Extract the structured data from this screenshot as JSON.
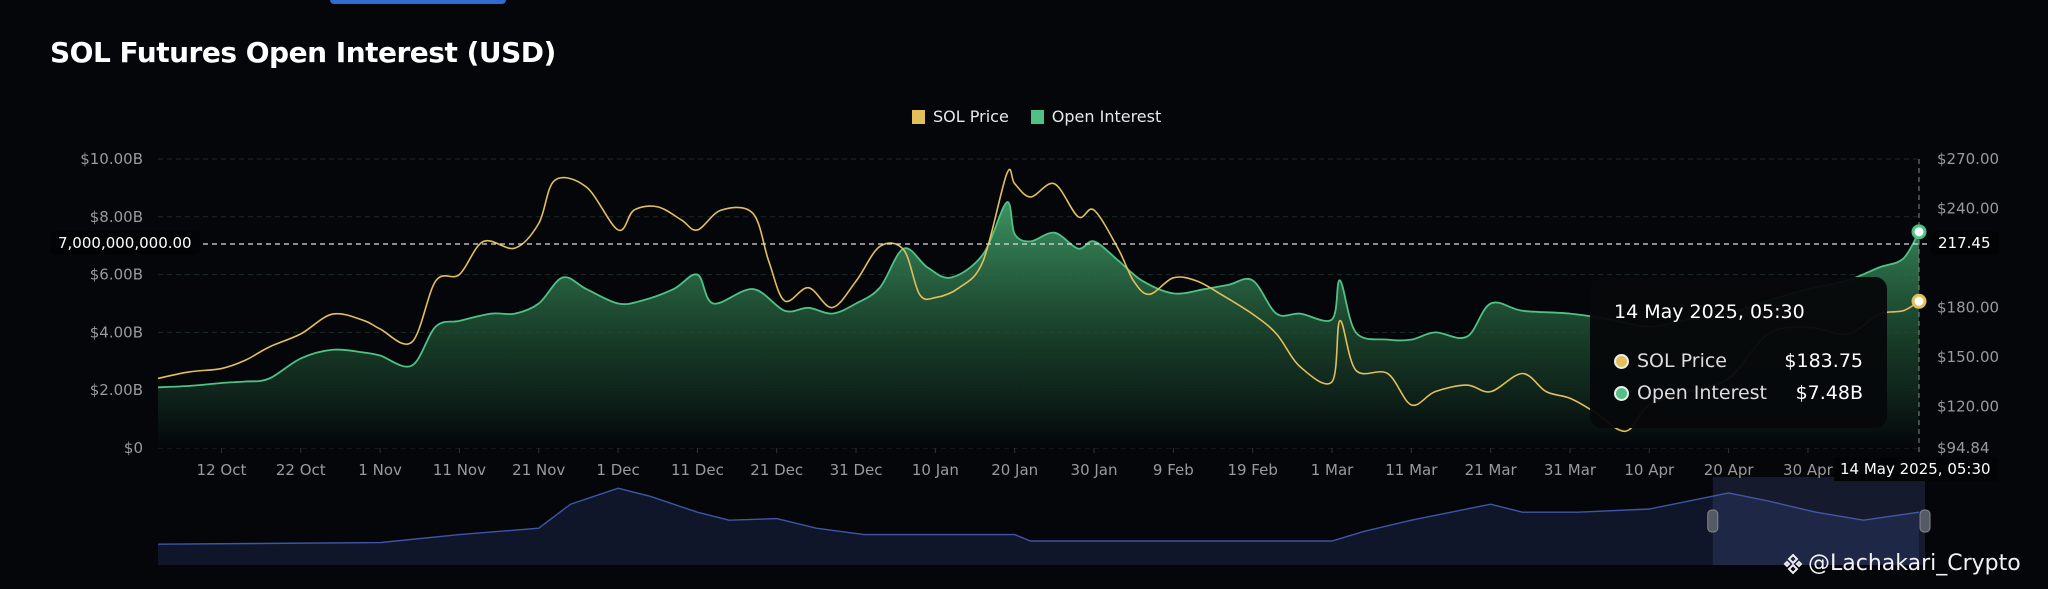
{
  "title": "SOL Futures Open Interest (USD)",
  "watermark": "@Lachakari_Crypto",
  "colors": {
    "price": "#e3bf5a",
    "oi": "#4fc185",
    "oi_fill": "#2f7a4e",
    "navigator": "#3f55a8",
    "bg": "#04060a"
  },
  "tooltip": {
    "date": "14 May 2025, 05:30",
    "rows": [
      {
        "label": "SOL Price",
        "value": "$183.75"
      },
      {
        "label": "Open Interest",
        "value": "$7.48B"
      }
    ]
  },
  "crosshair": {
    "left_label": "7,000,000,000.00",
    "right_label": "217.45",
    "date_label": "14 May 2025, 05:30"
  },
  "chart_data": {
    "type": "line",
    "title": "SOL Futures Open Interest (USD)",
    "legend": [
      "SOL Price",
      "Open Interest"
    ],
    "legend_position": "top-center",
    "x_range": [
      "2024-10-04",
      "2025-05-14"
    ],
    "x_ticks": [
      "12 Oct",
      "22 Oct",
      "1 Nov",
      "11 Nov",
      "21 Nov",
      "1 Dec",
      "11 Dec",
      "21 Dec",
      "31 Dec",
      "10 Jan",
      "20 Jan",
      "30 Jan",
      "9 Feb",
      "19 Feb",
      "1 Mar",
      "11 Mar",
      "21 Mar",
      "31 Mar",
      "10 Apr",
      "20 Apr",
      "30 Apr"
    ],
    "x_tick_dates": [
      "2024-10-12",
      "2024-10-22",
      "2024-11-01",
      "2024-11-11",
      "2024-11-21",
      "2024-12-01",
      "2024-12-11",
      "2024-12-21",
      "2024-12-31",
      "2025-01-10",
      "2025-01-20",
      "2025-01-30",
      "2025-02-09",
      "2025-02-19",
      "2025-03-01",
      "2025-03-11",
      "2025-03-21",
      "2025-03-31",
      "2025-04-10",
      "2025-04-20",
      "2025-04-30"
    ],
    "y_left": {
      "label": "Open Interest",
      "ylim": [
        0,
        10
      ],
      "unit": "B USD",
      "ticks": [
        "$0",
        "$2.00B",
        "$4.00B",
        "$6.00B",
        "$8.00B",
        "$10.00B"
      ],
      "tick_values": [
        0,
        2,
        4,
        6,
        8,
        10
      ]
    },
    "y_right": {
      "label": "SOL Price",
      "ylim": [
        94.84,
        270
      ],
      "ticks": [
        "$94.84",
        "$120.00",
        "$150.00",
        "$180.00",
        "$210.00",
        "$240.00",
        "$270.00"
      ],
      "tick_values": [
        94.84,
        120,
        150,
        180,
        210,
        240,
        270
      ]
    },
    "grid": true,
    "series": [
      {
        "name": "SOL Price",
        "axis": "right",
        "points": [
          [
            "2024-10-04",
            137
          ],
          [
            "2024-10-08",
            141
          ],
          [
            "2024-10-12",
            143
          ],
          [
            "2024-10-15",
            148
          ],
          [
            "2024-10-18",
            156
          ],
          [
            "2024-10-22",
            164
          ],
          [
            "2024-10-26",
            176
          ],
          [
            "2024-10-30",
            172
          ],
          [
            "2024-11-01",
            167
          ],
          [
            "2024-11-05",
            159
          ],
          [
            "2024-11-08",
            196
          ],
          [
            "2024-11-11",
            200
          ],
          [
            "2024-11-14",
            220
          ],
          [
            "2024-11-18",
            216
          ],
          [
            "2024-11-21",
            231
          ],
          [
            "2024-11-23",
            257
          ],
          [
            "2024-11-27",
            253
          ],
          [
            "2024-12-01",
            227
          ],
          [
            "2024-12-03",
            239
          ],
          [
            "2024-12-06",
            241
          ],
          [
            "2024-12-09",
            233
          ],
          [
            "2024-12-11",
            227
          ],
          [
            "2024-12-14",
            239
          ],
          [
            "2024-12-18",
            237
          ],
          [
            "2024-12-20",
            208
          ],
          [
            "2024-12-22",
            184
          ],
          [
            "2024-12-25",
            192
          ],
          [
            "2024-12-28",
            180
          ],
          [
            "2024-12-31",
            196
          ],
          [
            "2025-01-03",
            217
          ],
          [
            "2025-01-06",
            215
          ],
          [
            "2025-01-08",
            188
          ],
          [
            "2025-01-10",
            186
          ],
          [
            "2025-01-13",
            192
          ],
          [
            "2025-01-16",
            208
          ],
          [
            "2025-01-19",
            261
          ],
          [
            "2025-01-20",
            255
          ],
          [
            "2025-01-22",
            247
          ],
          [
            "2025-01-25",
            255
          ],
          [
            "2025-01-28",
            235
          ],
          [
            "2025-01-30",
            239
          ],
          [
            "2025-02-02",
            216
          ],
          [
            "2025-02-04",
            196
          ],
          [
            "2025-02-06",
            188
          ],
          [
            "2025-02-09",
            198
          ],
          [
            "2025-02-12",
            196
          ],
          [
            "2025-02-15",
            188
          ],
          [
            "2025-02-19",
            176
          ],
          [
            "2025-02-22",
            164
          ],
          [
            "2025-02-25",
            144
          ],
          [
            "2025-03-01",
            135
          ],
          [
            "2025-03-02",
            172
          ],
          [
            "2025-03-04",
            142
          ],
          [
            "2025-03-08",
            140
          ],
          [
            "2025-03-11",
            121
          ],
          [
            "2025-03-14",
            129
          ],
          [
            "2025-03-18",
            133
          ],
          [
            "2025-03-21",
            129
          ],
          [
            "2025-03-25",
            140
          ],
          [
            "2025-03-28",
            129
          ],
          [
            "2025-03-31",
            125
          ],
          [
            "2025-04-03",
            117
          ],
          [
            "2025-04-07",
            105
          ],
          [
            "2025-04-10",
            121
          ],
          [
            "2025-04-15",
            129
          ],
          [
            "2025-04-20",
            137
          ],
          [
            "2025-04-25",
            164
          ],
          [
            "2025-04-30",
            168
          ],
          [
            "2025-05-05",
            164
          ],
          [
            "2025-05-09",
            176
          ],
          [
            "2025-05-12",
            178
          ],
          [
            "2025-05-14",
            183.75
          ]
        ]
      },
      {
        "name": "Open Interest",
        "axis": "left",
        "unit": "B USD",
        "points": [
          [
            "2024-10-04",
            2.1
          ],
          [
            "2024-10-08",
            2.15
          ],
          [
            "2024-10-12",
            2.25
          ],
          [
            "2024-10-15",
            2.3
          ],
          [
            "2024-10-18",
            2.4
          ],
          [
            "2024-10-22",
            3.1
          ],
          [
            "2024-10-26",
            3.4
          ],
          [
            "2024-10-30",
            3.3
          ],
          [
            "2024-11-01",
            3.2
          ],
          [
            "2024-11-05",
            2.85
          ],
          [
            "2024-11-08",
            4.2
          ],
          [
            "2024-11-11",
            4.4
          ],
          [
            "2024-11-15",
            4.65
          ],
          [
            "2024-11-18",
            4.65
          ],
          [
            "2024-11-21",
            5.0
          ],
          [
            "2024-11-24",
            5.9
          ],
          [
            "2024-11-27",
            5.5
          ],
          [
            "2024-12-01",
            5.0
          ],
          [
            "2024-12-04",
            5.1
          ],
          [
            "2024-12-08",
            5.5
          ],
          [
            "2024-12-11",
            6.0
          ],
          [
            "2024-12-13",
            5.0
          ],
          [
            "2024-12-18",
            5.5
          ],
          [
            "2024-12-22",
            4.75
          ],
          [
            "2024-12-25",
            4.85
          ],
          [
            "2024-12-28",
            4.65
          ],
          [
            "2024-12-31",
            5.0
          ],
          [
            "2025-01-03",
            5.55
          ],
          [
            "2025-01-06",
            6.9
          ],
          [
            "2025-01-09",
            6.25
          ],
          [
            "2025-01-12",
            5.9
          ],
          [
            "2025-01-16",
            6.7
          ],
          [
            "2025-01-19",
            8.5
          ],
          [
            "2025-01-20",
            7.4
          ],
          [
            "2025-01-22",
            7.15
          ],
          [
            "2025-01-25",
            7.45
          ],
          [
            "2025-01-28",
            6.9
          ],
          [
            "2025-01-30",
            7.15
          ],
          [
            "2025-02-02",
            6.5
          ],
          [
            "2025-02-05",
            5.8
          ],
          [
            "2025-02-09",
            5.35
          ],
          [
            "2025-02-13",
            5.5
          ],
          [
            "2025-02-16",
            5.65
          ],
          [
            "2025-02-19",
            5.8
          ],
          [
            "2025-02-22",
            4.65
          ],
          [
            "2025-02-25",
            4.65
          ],
          [
            "2025-03-01",
            4.45
          ],
          [
            "2025-03-02",
            5.8
          ],
          [
            "2025-03-04",
            4.0
          ],
          [
            "2025-03-08",
            3.75
          ],
          [
            "2025-03-11",
            3.75
          ],
          [
            "2025-03-14",
            4.0
          ],
          [
            "2025-03-18",
            3.85
          ],
          [
            "2025-03-21",
            5.0
          ],
          [
            "2025-03-25",
            4.75
          ],
          [
            "2025-03-31",
            4.65
          ],
          [
            "2025-04-05",
            4.45
          ],
          [
            "2025-04-10",
            4.2
          ],
          [
            "2025-04-15",
            4.45
          ],
          [
            "2025-04-20",
            4.65
          ],
          [
            "2025-04-25",
            5.1
          ],
          [
            "2025-04-30",
            5.5
          ],
          [
            "2025-05-05",
            5.8
          ],
          [
            "2025-05-09",
            6.25
          ],
          [
            "2025-05-12",
            6.55
          ],
          [
            "2025-05-14",
            7.48
          ]
        ]
      }
    ],
    "navigator": {
      "range_selected": [
        "2025-04-18",
        "2025-05-14"
      ],
      "points": [
        [
          "2024-10-04",
          13
        ],
        [
          "2024-11-01",
          14
        ],
        [
          "2024-11-11",
          19
        ],
        [
          "2024-11-21",
          23
        ],
        [
          "2024-11-25",
          38
        ],
        [
          "2024-12-01",
          48
        ],
        [
          "2024-12-05",
          43
        ],
        [
          "2024-12-11",
          33
        ],
        [
          "2024-12-15",
          28
        ],
        [
          "2024-12-21",
          29
        ],
        [
          "2024-12-26",
          23
        ],
        [
          "2025-01-01",
          19
        ],
        [
          "2025-01-20",
          19
        ],
        [
          "2025-01-22",
          15
        ],
        [
          "2025-03-01",
          15
        ],
        [
          "2025-03-05",
          21
        ],
        [
          "2025-03-11",
          28
        ],
        [
          "2025-03-21",
          38
        ],
        [
          "2025-03-25",
          33
        ],
        [
          "2025-04-01",
          33
        ],
        [
          "2025-04-10",
          35
        ],
        [
          "2025-04-20",
          45
        ],
        [
          "2025-04-25",
          40
        ],
        [
          "2025-05-01",
          33
        ],
        [
          "2025-05-07",
          28
        ],
        [
          "2025-05-14",
          33
        ]
      ]
    }
  }
}
